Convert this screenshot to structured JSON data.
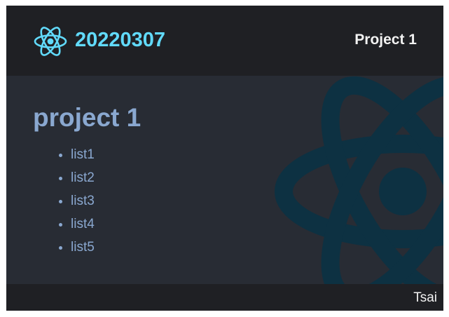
{
  "navbar": {
    "logo_icon": "react-atom-icon",
    "brand": "20220307",
    "link_label": "Project 1"
  },
  "main": {
    "title": "project 1",
    "items": [
      "list1",
      "list2",
      "list3",
      "list4",
      "list5"
    ],
    "background_icon": "react-atom-icon"
  },
  "footer": {
    "author": "Tsai"
  },
  "colors": {
    "accent": "#61dafb",
    "navbar_bg": "#1f2024",
    "main_bg": "#282c34",
    "text": "#8aa8d0",
    "nav_text": "#f2f2f2"
  }
}
